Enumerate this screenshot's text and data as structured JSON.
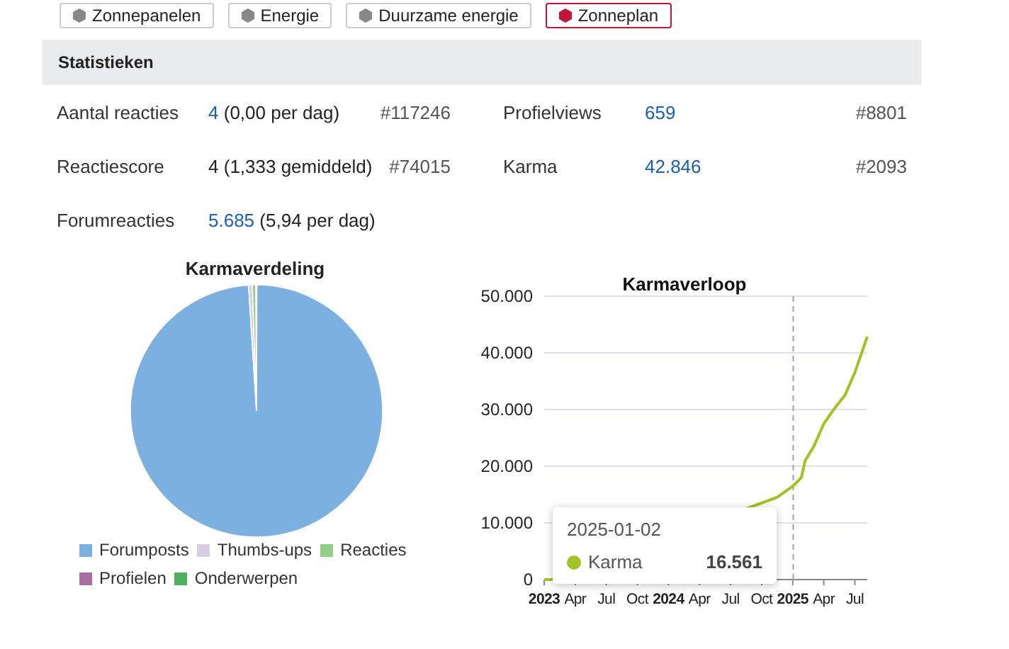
{
  "top_tabs": [
    {
      "label": "Zonnepanelen",
      "selected": false
    },
    {
      "label": "Energie",
      "selected": false
    },
    {
      "label": "Duurzame energie",
      "selected": false
    },
    {
      "label": "Zonneplan",
      "selected": true
    }
  ],
  "statistics": {
    "title": "Statistieken",
    "rows": [
      [
        {
          "label": "Aantal reacties",
          "value": "4",
          "value_link": true,
          "note": "(0,00 per dag)",
          "rank": "#117246"
        },
        {
          "label": "Profielviews",
          "value": "659",
          "value_link": true,
          "rank": "#8801"
        }
      ],
      [
        {
          "label": "Reactiescore",
          "value": "4",
          "value_link": false,
          "note": "(1,333 gemiddeld)",
          "rank": "#74015"
        },
        {
          "label": "Karma",
          "value": "42.846",
          "value_link": true,
          "rank": "#2093"
        }
      ],
      [
        {
          "label": "Forumreacties",
          "value": "5.685",
          "value_link": true,
          "note": "(5,94 per dag)"
        }
      ]
    ]
  },
  "karma_distribution": {
    "title": "Karmaverdeling",
    "legend": [
      {
        "label": "Forumposts",
        "color": "#7cb0e0"
      },
      {
        "label": "Thumbs-ups",
        "color": "#d9cde6"
      },
      {
        "label": "Reacties",
        "color": "#94cc8a"
      },
      {
        "label": "Profielen",
        "color": "#a8709f"
      },
      {
        "label": "Onderwerpen",
        "color": "#4caf62"
      }
    ]
  },
  "karma_history": {
    "chart_data": {
      "type": "line",
      "title": "Karmaverloop",
      "x": [
        2023,
        2023.06,
        2024.875,
        2025.004,
        2025.07,
        2025.1,
        2025.17,
        2025.25,
        2025.33,
        2025.42,
        2025.5,
        2025.6
      ],
      "series": [
        {
          "name": "Karma",
          "color": "#a3c224",
          "values": [
            0,
            0,
            14500,
            16561,
            18000,
            21000,
            23500,
            27500,
            30000,
            32500,
            36500,
            42846
          ]
        }
      ],
      "xlim": [
        2023,
        2025.6
      ],
      "ylim": [
        0,
        50000
      ],
      "grid": true,
      "ref_lines": [
        {
          "axis": "x",
          "value": 2025.004
        }
      ],
      "xticks": [
        {
          "value": 2023,
          "label": "2023"
        },
        {
          "value": 2023.25,
          "label": "Apr"
        },
        {
          "value": 2023.5,
          "label": "Jul"
        },
        {
          "value": 2023.75,
          "label": "Oct"
        },
        {
          "value": 2024,
          "label": "2024"
        },
        {
          "value": 2024.25,
          "label": "Apr"
        },
        {
          "value": 2024.5,
          "label": "Jul"
        },
        {
          "value": 2024.75,
          "label": "Oct"
        },
        {
          "value": 2025,
          "label": "2025"
        },
        {
          "value": 2025.25,
          "label": "Apr"
        },
        {
          "value": 2025.5,
          "label": "Jul"
        }
      ],
      "yticks": [
        {
          "value": 0,
          "label": "0"
        },
        {
          "value": 10000,
          "label": "10.000"
        },
        {
          "value": 20000,
          "label": "20.000"
        },
        {
          "value": 30000,
          "label": "30.000"
        },
        {
          "value": 40000,
          "label": "40.000"
        },
        {
          "value": 50000,
          "label": "50.000"
        }
      ]
    },
    "tooltip": {
      "date": "2025-01-02",
      "value": "16.561"
    }
  }
}
